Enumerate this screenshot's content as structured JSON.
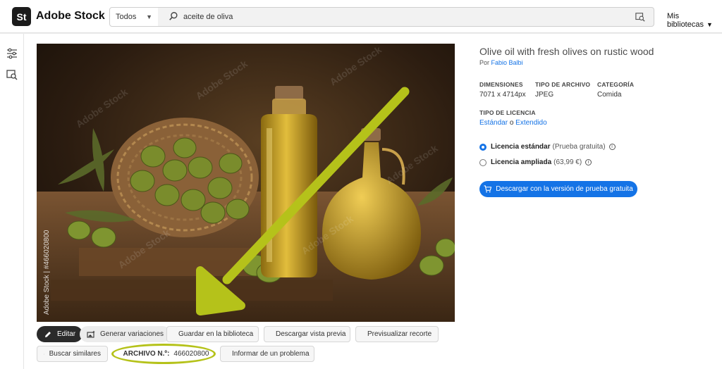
{
  "header": {
    "logo_badge": "St",
    "logo_text": "Adobe Stock",
    "filter_value": "Todos",
    "search_value": "aceite de oliva",
    "my_libraries": "Mis bibliotecas"
  },
  "photo": {
    "watermark": "Adobe Stock",
    "side_id": "Adobe Stock | #466020800"
  },
  "actions": {
    "edit": "Editar",
    "generate_variations": "Generar variaciones",
    "save_library": "Guardar en la biblioteca",
    "download_preview": "Descargar vista previa",
    "preview_crop": "Previsualizar recorte",
    "find_similar": "Buscar similares",
    "file_number_label": "ARCHIVO N.º:",
    "file_number": "466020800",
    "report_problem": "Informar de un problema"
  },
  "details": {
    "title": "Olive oil with fresh olives on rustic wood",
    "author_prefix": "Por",
    "author": "Fabio Balbi",
    "dimensions_label": "DIMENSIONES",
    "dimensions": "7071 x 4714px",
    "file_type_label": "TIPO DE ARCHIVO",
    "file_type": "JPEG",
    "category_label": "CATEGORÍA",
    "category": "Comida",
    "license_type_label": "TIPO DE LICENCIA",
    "license_standard_link": "Estándar",
    "license_or": "o",
    "license_extended_link": "Extendido"
  },
  "license_options": [
    {
      "name": "Licencia estándar",
      "note": "(Prueba gratuita)",
      "selected": true
    },
    {
      "name": "Licencia ampliada",
      "note": "(63,99 €)",
      "selected": false
    }
  ],
  "cta": {
    "label": "Descargar con la versión de prueba gratuita"
  },
  "colors": {
    "accent": "#1473e6",
    "annotation": "#b5c21a",
    "dark_button": "#2a2a2a"
  }
}
